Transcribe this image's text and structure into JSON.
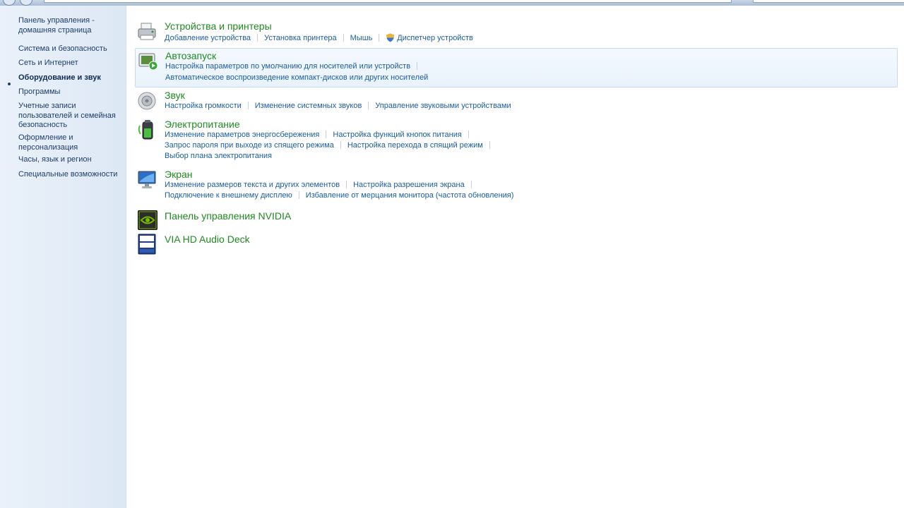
{
  "sidebar": {
    "items": [
      {
        "label": "Панель управления -\nдомашняя страница"
      },
      {
        "label": "Система и безопасность"
      },
      {
        "label": "Сеть и Интернет"
      },
      {
        "label": "Оборудование и звук",
        "active": true
      },
      {
        "label": "Программы"
      },
      {
        "label": "Учетные записи\nпользователей и семейная\nбезопасность"
      },
      {
        "label": "Оформление и\nперсонализация"
      },
      {
        "label": "Часы, язык и регион"
      },
      {
        "label": "Специальные возможности"
      }
    ]
  },
  "categories": [
    {
      "title": "Устройства и принтеры",
      "icon": "printer-icon",
      "links": [
        "Добавление устройства",
        "Установка принтера",
        "Мышь",
        "Диспетчер устройств"
      ]
    },
    {
      "title": "Автозапуск",
      "icon": "autoplay-icon",
      "links": [
        "Настройка параметров по умолчанию для носителей или устройств",
        "Автоматическое воспроизведение компакт-дисков или других носителей"
      ]
    },
    {
      "title": "Звук",
      "icon": "speaker-icon",
      "links": [
        "Настройка громкости",
        "Изменение системных звуков",
        "Управление звуковыми устройствами"
      ]
    },
    {
      "title": "Электропитание",
      "icon": "battery-icon",
      "links": [
        "Изменение параметров энергосбережения",
        "Настройка функций кнопок питания",
        "Запрос пароля при выходе из спящего режима",
        "Настройка перехода в спящий режим",
        "Выбор плана электропитания"
      ]
    },
    {
      "title": "Экран",
      "icon": "monitor-icon",
      "links": [
        "Изменение размеров текста и других элементов",
        "Настройка разрешения экрана",
        "Подключение к внешнему дисплею",
        "Избавление от мерцания монитора (частота обновления)"
      ]
    },
    {
      "title": "Панель управления NVIDIA",
      "icon": "nvidia-icon",
      "links": []
    },
    {
      "title": "VIA HD Audio Deck",
      "icon": "via-vinyl-icon",
      "links": []
    }
  ],
  "colors": {
    "title_green": "#1f8a1f",
    "link_blue": "#1b5ea3",
    "sidebar_text": "#1e3d69"
  }
}
